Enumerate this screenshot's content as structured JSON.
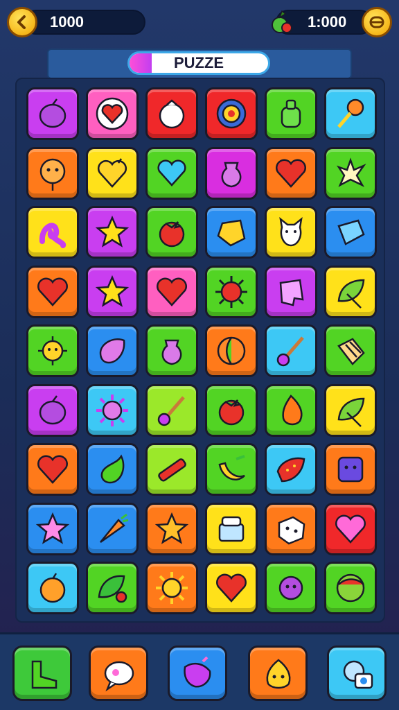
{
  "header": {
    "left_counter": "1000",
    "right_counter": "1:000",
    "back_icon": "chevron-left-icon",
    "currency_icon": "coin-icon",
    "fruit_icon": "berry-icon"
  },
  "title": {
    "label": "PUZZE",
    "progress": 0.16
  },
  "colors": {
    "purple": "#c93ef0",
    "pink": "#ff5fc0",
    "red": "#f0282a",
    "green": "#52d424",
    "cyan": "#3dc8f5",
    "orange": "#ff7a1a",
    "yellow": "#ffe11a",
    "blue": "#2b8ef0",
    "lime": "#9be82a",
    "magenta": "#d92ee0"
  },
  "board": {
    "rows": [
      [
        {
          "c": "purple",
          "i": "plum"
        },
        {
          "c": "pink",
          "i": "heart-bubble"
        },
        {
          "c": "red",
          "i": "white-bulb"
        },
        {
          "c": "red",
          "i": "gem-ring"
        },
        {
          "c": "green",
          "i": "green-bottle"
        },
        {
          "c": "cyan",
          "i": "lollipop"
        }
      ],
      [
        {
          "c": "orange",
          "i": "flower-face"
        },
        {
          "c": "yellow",
          "i": "heart-fruit"
        },
        {
          "c": "green",
          "i": "blue-heart"
        },
        {
          "c": "magenta",
          "i": "vase"
        },
        {
          "c": "orange",
          "i": "heart"
        },
        {
          "c": "green",
          "i": "splash"
        }
      ],
      [
        {
          "c": "yellow",
          "i": "squiggle"
        },
        {
          "c": "purple",
          "i": "star"
        },
        {
          "c": "green",
          "i": "tomato"
        },
        {
          "c": "blue",
          "i": "yellow-gem"
        },
        {
          "c": "yellow",
          "i": "cat"
        },
        {
          "c": "blue",
          "i": "blue-block"
        }
      ],
      [
        {
          "c": "orange",
          "i": "heart"
        },
        {
          "c": "purple",
          "i": "star"
        },
        {
          "c": "pink",
          "i": "heart"
        },
        {
          "c": "green",
          "i": "sun-ball"
        },
        {
          "c": "purple",
          "i": "pink-block"
        },
        {
          "c": "yellow",
          "i": "leaf"
        }
      ],
      [
        {
          "c": "green",
          "i": "sun-face"
        },
        {
          "c": "blue",
          "i": "pink-drop"
        },
        {
          "c": "green",
          "i": "vase"
        },
        {
          "c": "orange",
          "i": "beach-ball"
        },
        {
          "c": "cyan",
          "i": "wand"
        },
        {
          "c": "green",
          "i": "bread"
        }
      ],
      [
        {
          "c": "purple",
          "i": "plum"
        },
        {
          "c": "cyan",
          "i": "pink-flower"
        },
        {
          "c": "lime",
          "i": "wand"
        },
        {
          "c": "green",
          "i": "tomato"
        },
        {
          "c": "green",
          "i": "orange-drop"
        },
        {
          "c": "yellow",
          "i": "leaf"
        }
      ],
      [
        {
          "c": "orange",
          "i": "heart"
        },
        {
          "c": "blue",
          "i": "green-drop"
        },
        {
          "c": "lime",
          "i": "red-stick"
        },
        {
          "c": "green",
          "i": "banana"
        },
        {
          "c": "cyan",
          "i": "strawberry"
        },
        {
          "c": "orange",
          "i": "purple-box"
        }
      ],
      [
        {
          "c": "blue",
          "i": "pink-star"
        },
        {
          "c": "blue",
          "i": "carrot"
        },
        {
          "c": "orange",
          "i": "gold-star"
        },
        {
          "c": "yellow",
          "i": "sushi"
        },
        {
          "c": "orange",
          "i": "dice"
        },
        {
          "c": "red",
          "i": "pink-heart"
        }
      ],
      [
        {
          "c": "cyan",
          "i": "peach"
        },
        {
          "c": "green",
          "i": "leaf-berry"
        },
        {
          "c": "orange",
          "i": "sun"
        },
        {
          "c": "yellow",
          "i": "heart"
        },
        {
          "c": "green",
          "i": "purple-flower"
        },
        {
          "c": "green",
          "i": "ball"
        }
      ]
    ]
  },
  "toolbar": {
    "buttons": [
      {
        "c": "#3ec93a",
        "i": "boot-icon"
      },
      {
        "c": "#ff7a1a",
        "i": "bubble-icon"
      },
      {
        "c": "#2b8ef0",
        "i": "berry-icon"
      },
      {
        "c": "#ff7a1a",
        "i": "face-icon"
      },
      {
        "c": "#3dc8f5",
        "i": "gear-photo-icon"
      }
    ]
  }
}
